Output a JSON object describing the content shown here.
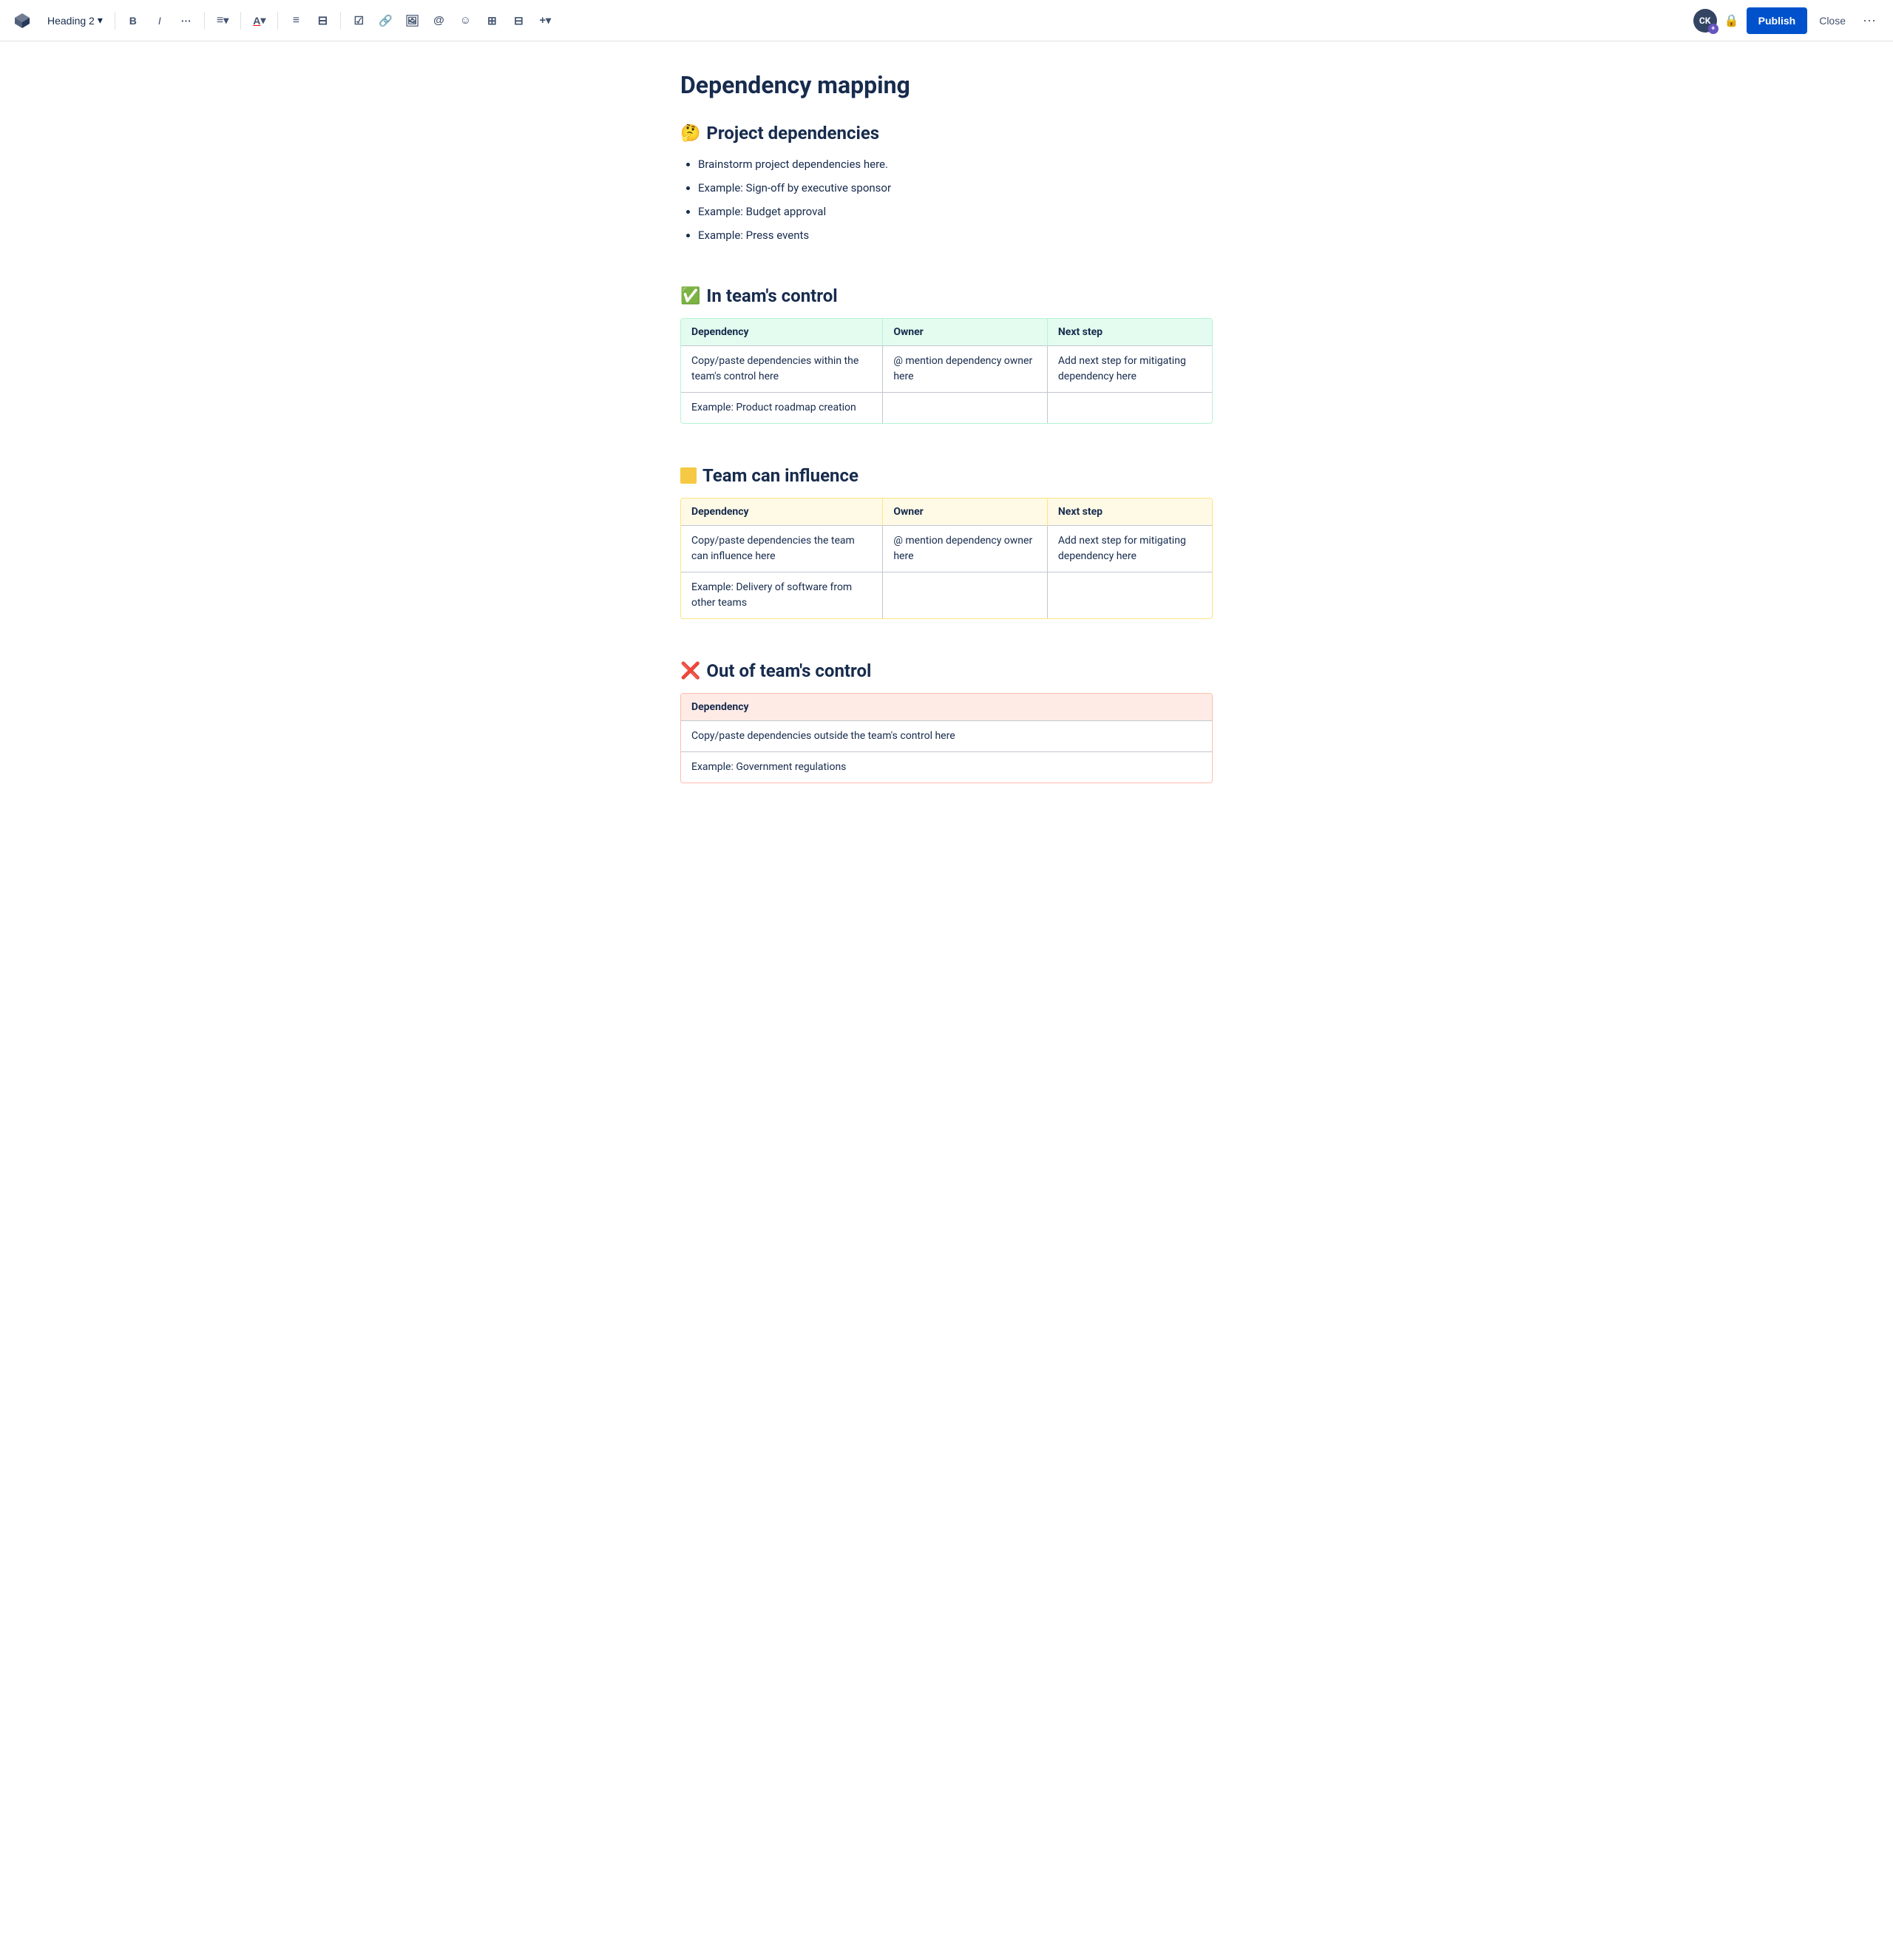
{
  "toolbar": {
    "heading_label": "Heading 2",
    "chevron": "▾",
    "bold": "B",
    "italic": "I",
    "more_format": "···",
    "align_icon": "≡",
    "color_icon": "A",
    "bullet_list": "•",
    "numbered_list": "⒈",
    "task": "☑",
    "link": "⎘",
    "image": "⬜",
    "mention": "@",
    "emoji": "☺",
    "table_icon": "⊞",
    "layout_icon": "⊟",
    "insert_plus": "+",
    "avatar_initials": "CK",
    "avatar_badge": "+",
    "publish_label": "Publish",
    "close_label": "Close",
    "more_options": "···"
  },
  "page": {
    "title": "Dependency mapping",
    "sections": [
      {
        "icon": "🤔",
        "heading": "Project dependencies",
        "type": "list",
        "items": [
          "Brainstorm project dependencies here.",
          "Example: Sign-off by executive sponsor",
          "Example: Budget approval",
          "Example: Press events"
        ]
      },
      {
        "icon": "✅",
        "heading": "In team's control",
        "type": "table",
        "theme": "green",
        "columns": [
          "Dependency",
          "Owner",
          "Next step"
        ],
        "rows": [
          [
            "Copy/paste dependencies within the team's control here",
            "@ mention dependency owner here",
            "Add next step for mitigating dependency here"
          ],
          [
            "Example: Product roadmap creation",
            "",
            ""
          ]
        ]
      },
      {
        "icon": "🟨",
        "heading": "Team can influence",
        "type": "table",
        "theme": "yellow",
        "columns": [
          "Dependency",
          "Owner",
          "Next step"
        ],
        "rows": [
          [
            "Copy/paste dependencies the team can influence here",
            "@ mention dependency owner here",
            "Add next step for mitigating dependency here"
          ],
          [
            "Example: Delivery of software from other teams",
            "",
            ""
          ]
        ]
      },
      {
        "icon": "❌",
        "heading": "Out of team's control",
        "type": "table",
        "theme": "red",
        "columns": [
          "Dependency"
        ],
        "rows": [
          [
            "Copy/paste dependencies outside the team's control here"
          ],
          [
            "Example: Government regulations"
          ]
        ]
      }
    ]
  }
}
